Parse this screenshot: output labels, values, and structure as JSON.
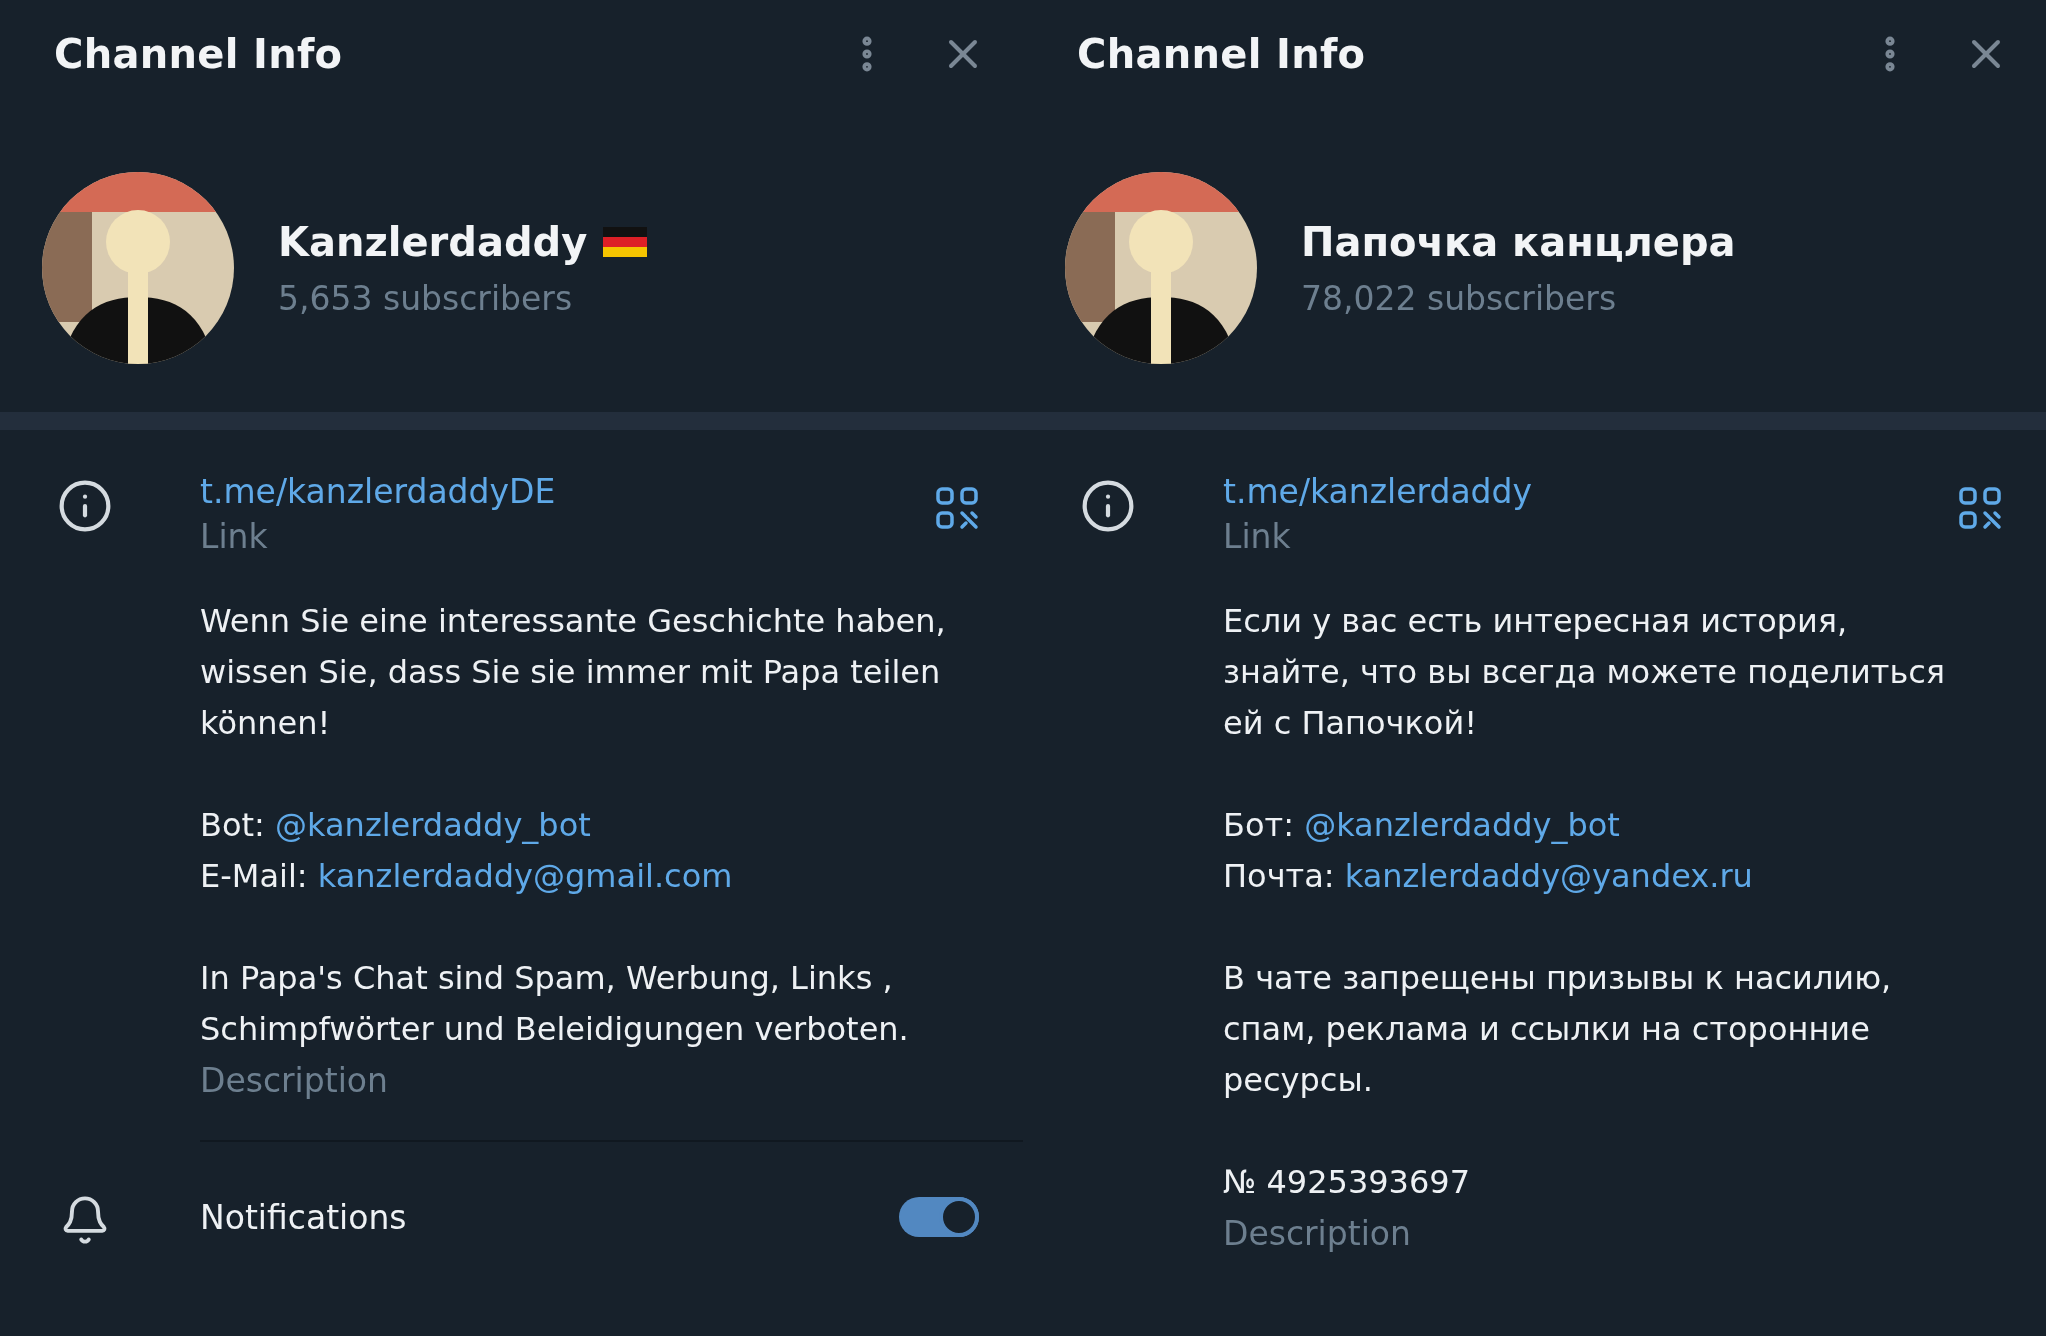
{
  "panels": [
    {
      "title": "Channel Info",
      "channel": {
        "name": "Kanzlerdaddy",
        "name_badge": true,
        "subscribers": "5,653 subscribers"
      },
      "link": {
        "url": "t.me/kanzlerdaddyDE",
        "label": "Link"
      },
      "description": {
        "blocks": [
          {
            "kind": "text",
            "text": "Wenn Sie eine interessante Geschichte haben, wissen Sie, dass Sie sie immer mit Papa teilen können!"
          },
          {
            "kind": "contacts",
            "lines": [
              {
                "label": "Bot:",
                "link": "@kanzlerdaddy_bot"
              },
              {
                "label": "E-Mail:",
                "link": "kanzlerdaddy@gmail.com"
              }
            ]
          },
          {
            "kind": "text",
            "text": "In Papa's Chat sind Spam, Werbung, Links , Schimpfwörter und Beleidigungen verboten."
          }
        ],
        "label": "Description"
      },
      "notifications": {
        "label": "Notifications",
        "on": true
      }
    },
    {
      "title": "Channel Info",
      "channel": {
        "name": "Папочка канцлера",
        "subscribers": "78,022 subscribers"
      },
      "link": {
        "url": "t.me/kanzlerdaddy",
        "label": "Link"
      },
      "description": {
        "blocks": [
          {
            "kind": "text",
            "text": "Если у вас есть интересная история, знайте, что вы всегда можете поделиться ей с Папочкой!"
          },
          {
            "kind": "contacts",
            "lines": [
              {
                "label": "Бот:",
                "link": "@kanzlerdaddy_bot"
              },
              {
                "label": "Почта:",
                "link": "kanzlerdaddy@yandex.ru"
              }
            ]
          },
          {
            "kind": "text",
            "text": "В чате запрещены призывы к насилию, спам, реклама и ссылки на сторонние ресурсы."
          },
          {
            "kind": "text",
            "text": "№ 4925393697"
          }
        ],
        "label": "Description"
      }
    }
  ]
}
